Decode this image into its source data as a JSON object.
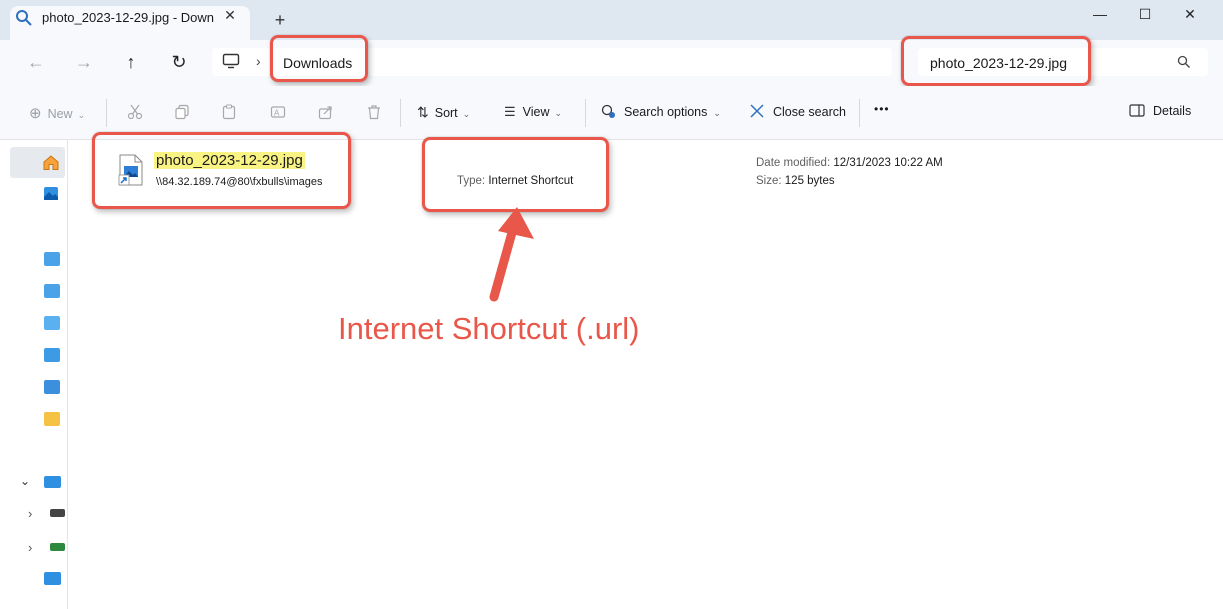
{
  "tab": {
    "title": "photo_2023-12-29.jpg - Downl",
    "close": "✕",
    "new_tab": "+"
  },
  "window_controls": {
    "minimize": "—",
    "maximize": "☐",
    "close": "✕"
  },
  "nav": {
    "back": "←",
    "forward": "→",
    "up": "↑",
    "refresh": "↻",
    "breadcrumb_sep": "›"
  },
  "address_bar": {
    "location": "Downloads"
  },
  "search_box": {
    "value": "photo_2023-12-29.jpg"
  },
  "toolbar": {
    "new_label": "New",
    "sort_label": "Sort",
    "view_label": "View",
    "search_options_label": "Search options",
    "close_search_label": "Close search",
    "more_label": "•••",
    "details_label": "Details"
  },
  "file": {
    "name": "photo_2023-12-29.jpg",
    "path": "\\\\84.32.189.74@80\\fxbulls\\images",
    "type_label": "Type:",
    "type_value": "Internet Shortcut",
    "modified_label": "Date modified:",
    "modified_value": "12/31/2023 10:22 AM",
    "size_label": "Size:",
    "size_value": "125 bytes"
  },
  "annotation": {
    "text": "Internet Shortcut (.url)"
  },
  "colors": {
    "annotation_red": "#e8574a",
    "highlight_yellow": "#f9f383",
    "accent_blue": "#0067c0"
  }
}
